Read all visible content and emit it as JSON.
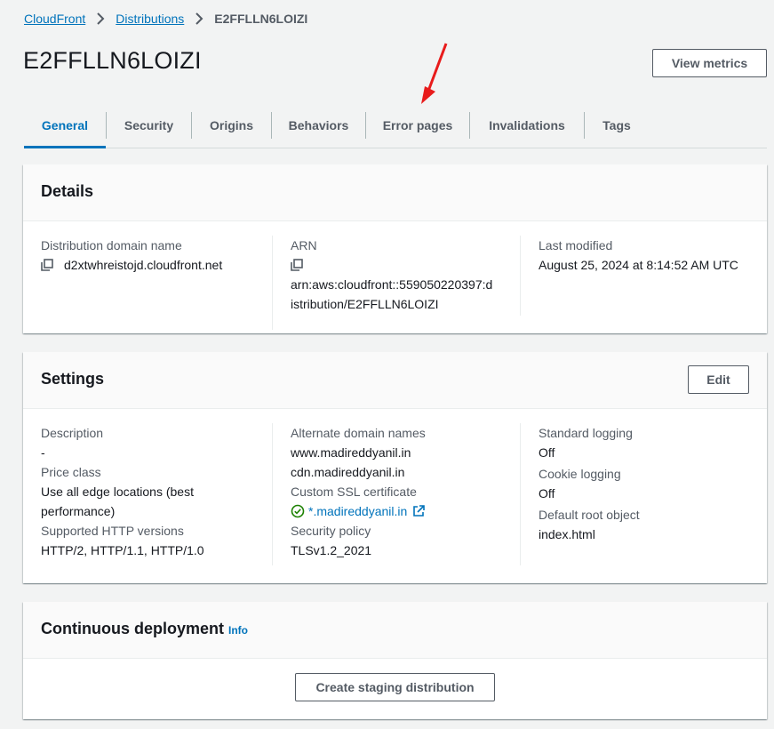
{
  "breadcrumb": {
    "root": "CloudFront",
    "parent": "Distributions",
    "current": "E2FFLLN6LOIZI"
  },
  "page": {
    "title": "E2FFLLN6LOIZI",
    "view_metrics": "View metrics"
  },
  "tabs": [
    {
      "label": "General"
    },
    {
      "label": "Security"
    },
    {
      "label": "Origins"
    },
    {
      "label": "Behaviors"
    },
    {
      "label": "Error pages"
    },
    {
      "label": "Invalidations"
    },
    {
      "label": "Tags"
    }
  ],
  "details": {
    "title": "Details",
    "domain_label": "Distribution domain name",
    "domain_value": "d2xtwhreistojd.cloudfront.net",
    "arn_label": "ARN",
    "arn_line1": "arn:aws:cloudfront::559050220397:d",
    "arn_line2": "istribution/E2FFLLN6LOIZI",
    "modified_label": "Last modified",
    "modified_value": "August 25, 2024 at 8:14:52 AM UTC"
  },
  "settings": {
    "title": "Settings",
    "edit": "Edit",
    "description_label": "Description",
    "description_value": "-",
    "price_label": "Price class",
    "price_line1": "Use all edge locations (best",
    "price_line2": "performance)",
    "http_label": "Supported HTTP versions",
    "http_value": "HTTP/2, HTTP/1.1, HTTP/1.0",
    "alt_label": "Alternate domain names",
    "alt_1": "www.madireddyanil.in",
    "alt_2": "cdn.madireddyanil.in",
    "ssl_label": "Custom SSL certificate",
    "ssl_value": "*.madireddyanil.in",
    "policy_label": "Security policy",
    "policy_value": "TLSv1.2_2021",
    "std_log_label": "Standard logging",
    "std_log_value": "Off",
    "cookie_log_label": "Cookie logging",
    "cookie_log_value": "Off",
    "root_obj_label": "Default root object",
    "root_obj_value": "index.html"
  },
  "continuous": {
    "title": "Continuous deployment",
    "info": "Info",
    "button": "Create staging distribution"
  },
  "colors": {
    "accent": "#0073bb",
    "success": "#1d8102",
    "annotation": "#e81b1b"
  }
}
